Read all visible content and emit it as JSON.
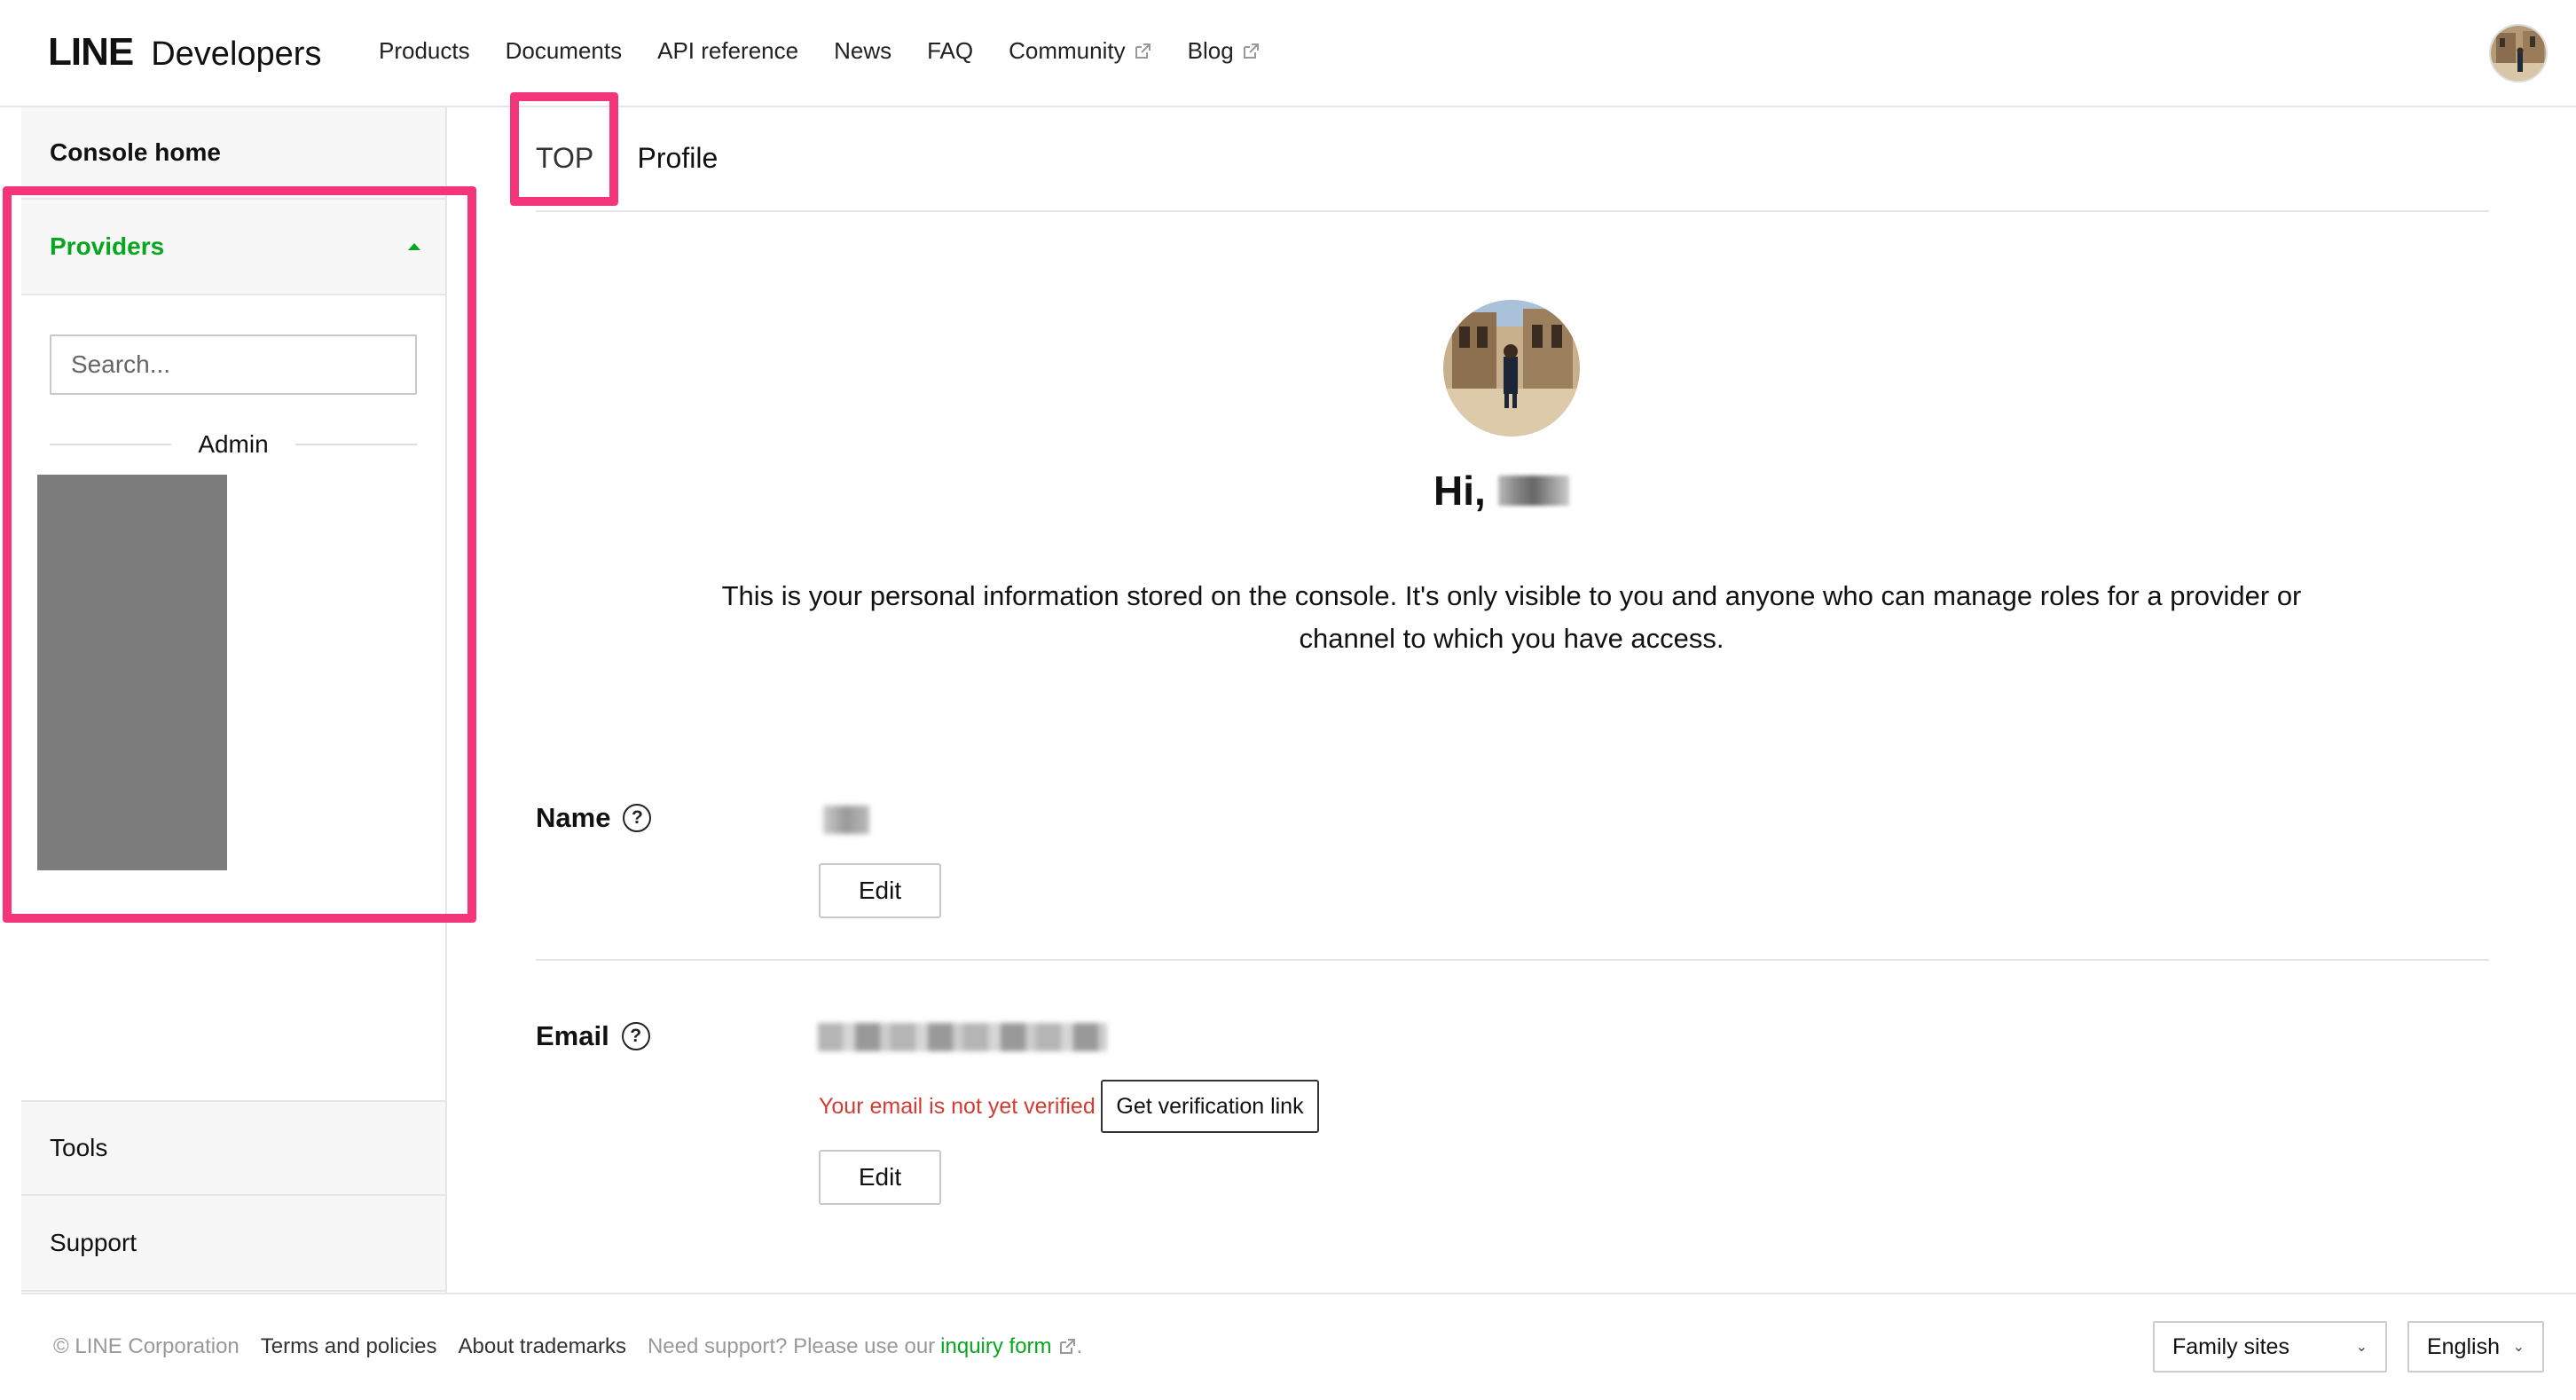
{
  "header": {
    "logo_line": "LINE",
    "logo_developers": "Developers",
    "nav": [
      {
        "label": "Products"
      },
      {
        "label": "Documents"
      },
      {
        "label": "API reference"
      },
      {
        "label": "News"
      },
      {
        "label": "FAQ"
      },
      {
        "label": "Community"
      },
      {
        "label": "Blog"
      }
    ]
  },
  "sidebar": {
    "console_home": "Console home",
    "providers": "Providers",
    "search_placeholder": "Search...",
    "admin": "Admin",
    "tools": "Tools",
    "support": "Support"
  },
  "breadcrumb": {
    "top": "TOP",
    "separator": "›",
    "current": "Profile"
  },
  "profile": {
    "greeting": "Hi,",
    "intro": "This is your personal information stored on the console. It's only visible to you and anyone who can manage roles for a provider or channel to which you have access.",
    "name_label": "Name",
    "email_label": "Email",
    "help_symbol": "?",
    "edit_label": "Edit",
    "email_warning": "Your email is not yet verified",
    "verify_button": "Get verification link"
  },
  "footer": {
    "copyright": "© LINE Corporation",
    "terms": "Terms and policies",
    "trademarks": "About trademarks",
    "support_text": "Need support? Please use our",
    "inquiry": "inquiry form",
    "period": ".",
    "family_sites": "Family sites",
    "language": "English"
  },
  "colors": {
    "brand_green": "#06a61e",
    "highlight_pink": "#f5357a",
    "warning_red": "#d43b31"
  },
  "icons": [
    "external-link-icon",
    "help-icon",
    "caret-up-icon",
    "chevron-down-icon",
    "avatar"
  ]
}
